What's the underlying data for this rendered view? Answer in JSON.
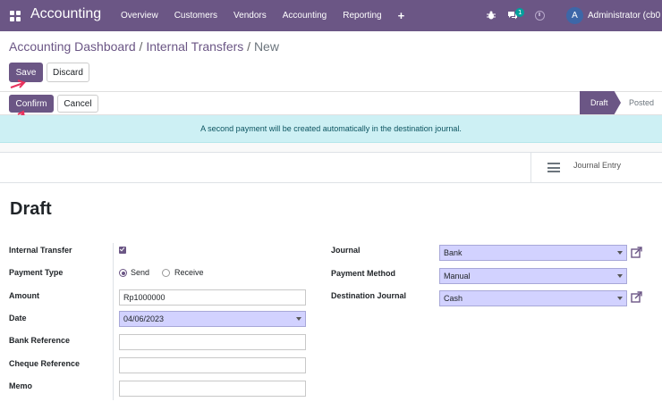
{
  "navbar": {
    "brand": "Accounting",
    "menu": [
      "Overview",
      "Customers",
      "Vendors",
      "Accounting",
      "Reporting"
    ],
    "plus": "+",
    "chat_count": "1",
    "avatar_letter": "A",
    "user_name": "Administrator (cb0"
  },
  "breadcrumb": {
    "parent1": "Accounting Dashboard",
    "parent2": "Internal Transfers",
    "current": "New",
    "separator": "/"
  },
  "buttons": {
    "save": "Save",
    "discard": "Discard",
    "confirm": "Confirm",
    "cancel": "Cancel"
  },
  "statusbar": {
    "stages": [
      "Draft",
      "Posted"
    ],
    "active": "Draft"
  },
  "alert": "A second payment will be created automatically in the destination journal.",
  "smart_button": "Journal Entry",
  "record": {
    "title": "Draft",
    "labels": {
      "internal_transfer": "Internal Transfer",
      "payment_type": "Payment Type",
      "amount": "Amount",
      "date": "Date",
      "bank_reference": "Bank Reference",
      "cheque_reference": "Cheque Reference",
      "memo": "Memo",
      "journal": "Journal",
      "payment_method": "Payment Method",
      "destination_journal": "Destination Journal"
    },
    "values": {
      "internal_transfer": true,
      "payment_type_options": [
        "Send",
        "Receive"
      ],
      "payment_type_selected": "Send",
      "amount": "Rp1000000",
      "date": "04/06/2023",
      "bank_reference": "",
      "cheque_reference": "",
      "memo": "",
      "journal": "Bank",
      "payment_method": "Manual",
      "destination_journal": "Cash"
    }
  },
  "colors": {
    "brand": "#6b5685",
    "required_field": "#d2d2ff",
    "alert_bg": "#cdf0f4",
    "annotation_arrow": "#e8335e"
  }
}
